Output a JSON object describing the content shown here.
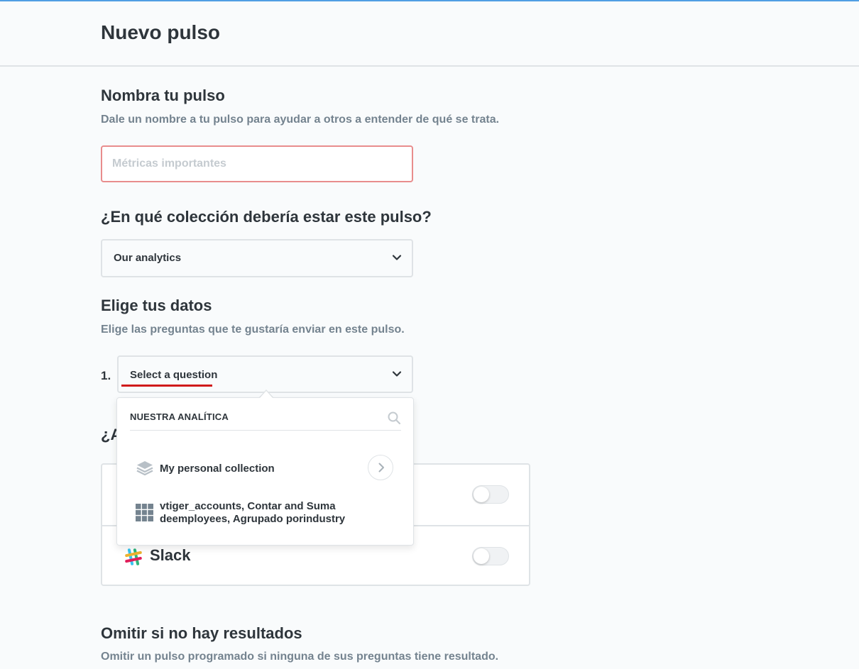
{
  "header": {
    "title": "Nuevo pulso"
  },
  "name_section": {
    "title": "Nombra tu pulso",
    "subtitle": "Dale un nombre a tu pulso para ayudar a otros a entender de qué se trata.",
    "input_placeholder": "Métricas importantes",
    "input_value": ""
  },
  "collection_section": {
    "title": "¿En qué colección debería estar este pulso?",
    "selected": "Our analytics"
  },
  "data_section": {
    "title": "Elige tus datos",
    "subtitle": "Elige las preguntas que te gustaría enviar en este pulso.",
    "question_number": "1.",
    "question_select_label": "Select a question"
  },
  "popover": {
    "header": "NUESTRA ANALÍTICA",
    "items": [
      {
        "label": "My personal collection",
        "icon": "collection-stack-icon"
      },
      {
        "label_line1": "vtiger_accounts, Contar and Suma",
        "label_line2": "deemployees, Agrupado porindustry",
        "icon": "table-grid-icon"
      }
    ]
  },
  "channels_section": {
    "partial_title": "¿A",
    "channels": [
      {
        "name": "",
        "enabled": false
      },
      {
        "name": "Slack",
        "enabled": false,
        "icon": "slack-icon"
      }
    ]
  },
  "skip_section": {
    "title": "Omitir si no hay resultados",
    "subtitle": "Omitir un pulso programado si ninguna de sus preguntas tiene resultado."
  },
  "colors": {
    "accent": "#509ee3",
    "error_border": "#e88d8d",
    "underline": "#d01a1a",
    "text": "#2e353b",
    "muted": "#74838f"
  }
}
